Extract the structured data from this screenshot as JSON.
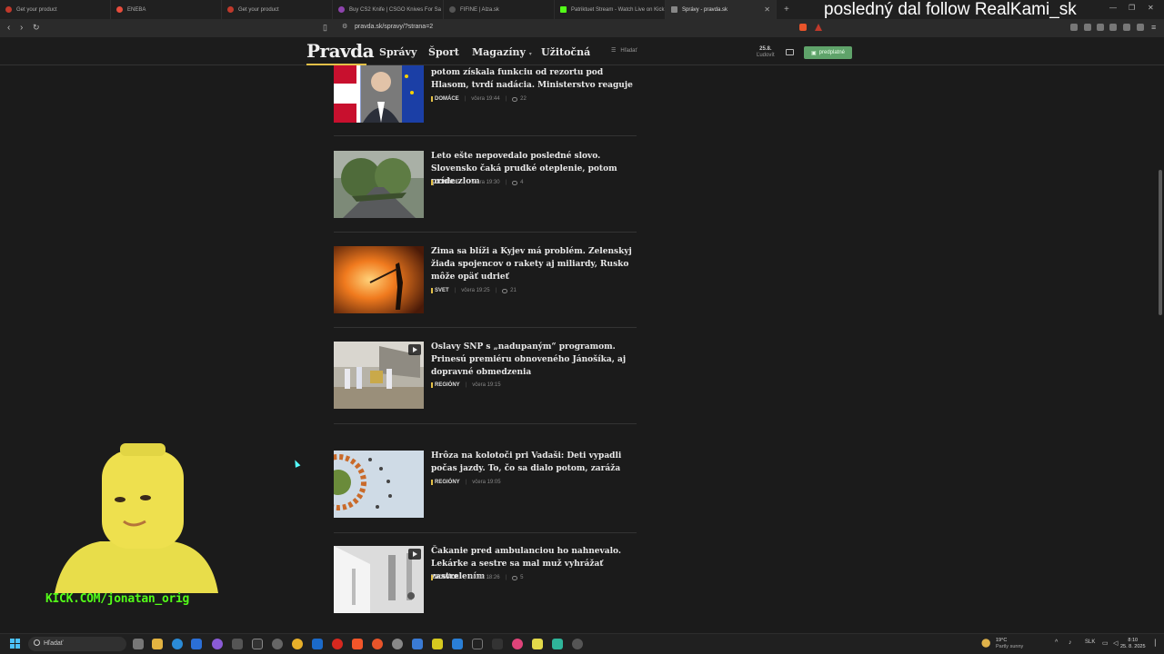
{
  "browser": {
    "tabs": [
      {
        "label": "Get your product",
        "color": "#c0392b",
        "active": false
      },
      {
        "label": "ENEBA",
        "color": "#e74c3c",
        "active": false
      },
      {
        "label": "Get your product",
        "color": "#c0392b",
        "active": false
      },
      {
        "label": "Buy CS2 Knife | CSGO Knives For Sa",
        "color": "#8e44ad",
        "active": false
      },
      {
        "label": "FIFINE | Alza.sk",
        "color": "#555555",
        "active": false
      },
      {
        "label": "Patriktuet Stream - Watch Live on Kick",
        "color": "#53fc18",
        "active": false
      },
      {
        "label": "Správy - pravda.sk",
        "color": "#888888",
        "active": true
      }
    ],
    "new_tab": "+",
    "url": "pravda.sk/spravy/?strana=2"
  },
  "stream_overlay": {
    "follow_text": "posledný dal follow RealKami_sk",
    "kick_url": "KICK.COM/jonatan_orig"
  },
  "site": {
    "logo": "Pravda",
    "nav": [
      "Správy",
      "Šport",
      "Magazíny",
      "Užitočná"
    ],
    "search_placeholder": "Hľadať",
    "date_day": "25.8.",
    "date_name": "Ľudovít",
    "subscribe": "predplatné",
    "accent_color": "#e3c048"
  },
  "articles": [
    {
      "title": "potom získala funkciu od rezortu pod Hlasom, tvrdí nadácia. Ministerstvo reaguje",
      "category": "DOMÁCE",
      "time": "včera 19:44",
      "comments": "22",
      "video": false
    },
    {
      "title": "Leto ešte nepovedalo posledné slovo. Slovensko čaká prudké oteplenie, potom príde zlom",
      "category": "DOMÁCE",
      "time": "včera 19:30",
      "comments": "4",
      "video": false
    },
    {
      "title": "Zima sa blíži a Kyjev má problém. Zelenskyj žiada spojencov o rakety aj miliardy, Rusko môže opäť udrieť",
      "category": "SVET",
      "time": "včera 19:25",
      "comments": "21",
      "video": false
    },
    {
      "title": "Oslavy SNP s „nadupaným“ programom. Prinesú premiéru obnoveného Jánošíka, aj dopravné obmedzenia",
      "category": "REGIÓNY",
      "time": "včera 19:15",
      "comments": "",
      "video": true
    },
    {
      "title": "Hrôza na kolotoči pri Vadaši: Deti vypadli počas jazdy. To, čo sa dialo potom, zaráža",
      "category": "REGIÓNY",
      "time": "včera 19:05",
      "comments": "",
      "video": false
    },
    {
      "title": "Čakanie pred ambulanciou ho nahnevalo. Lekárke a sestre sa mal muž vyhrážať zastrelením",
      "category": "DOMÁCE",
      "time": "včera 18:26",
      "comments": "5",
      "video": true
    }
  ],
  "taskbar": {
    "search": "Hľadať",
    "weather_temp": "19°C",
    "weather_desc": "Partly sunny",
    "lang": "SLK",
    "time": "8:10",
    "date": "25. 8. 2025"
  }
}
